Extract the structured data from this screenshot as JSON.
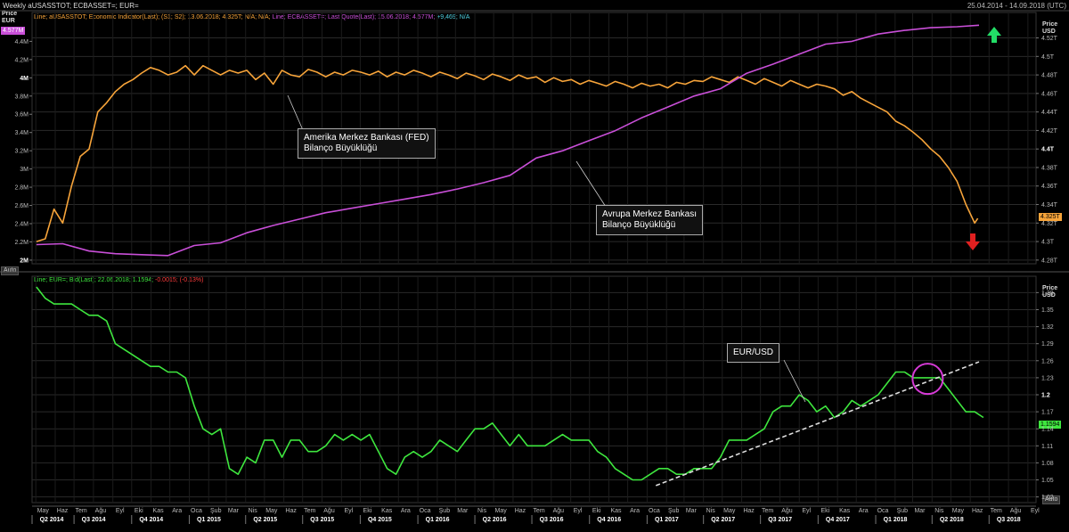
{
  "header": {
    "title": "Weekly aUSASSTOT; ECBASSET=; EUR=",
    "date_range": "25.04.2014 - 14.09.2018 (UTC)"
  },
  "top_panel": {
    "legend_parts": [
      {
        "text": "Line; aUSASSTOT; Economic Indicator(Last); (S1; S2); 13.06.2018; 4.325T; N/A; N/A;",
        "color": "#f7a43a"
      },
      {
        "text": " Line; ECBASSET=; Last Quote(Last); 15.06.2018; 4.577M;",
        "color": "#c94fd8"
      },
      {
        "text": " +9,469; N/A",
        "color": "#4fd0e0"
      }
    ],
    "left_axis_title": "Price",
    "left_axis_unit": "EUR",
    "left_chip": "4.577M",
    "right_axis_title": "Price",
    "right_axis_unit": "USD",
    "right_chip": "4.325T",
    "auto_label": "Auto"
  },
  "bottom_panel": {
    "legend_parts": [
      {
        "text": "Line; EUR=; Bid(Last); 22.06.2018; 1.1594;",
        "color": "#3ee63e"
      },
      {
        "text": " -0.0015; (-0.13%)",
        "color": "#ff3b3b"
      }
    ],
    "right_axis_title": "Price",
    "right_axis_unit": "USD",
    "right_chip": "1.1594",
    "auto_label": "Auto"
  },
  "annotations": {
    "fed": [
      "Amerika Merkez Bankası (FED)",
      "Bilanço Büyüklüğü"
    ],
    "ecb": [
      "Avrupa Merkez Bankası",
      "Bilanço Büyüklüğü"
    ],
    "eurusd": [
      "EUR/USD"
    ]
  },
  "x_axis": {
    "months": [
      "May",
      "Haz",
      "Tem",
      "Ağu",
      "Eyl",
      "Eki",
      "Kas",
      "Ara",
      "Oca",
      "Şub",
      "Mar",
      "Nis",
      "May",
      "Haz",
      "Tem",
      "Ağu",
      "Eyl",
      "Eki",
      "Kas",
      "Ara",
      "Oca",
      "Şub",
      "Mar",
      "Nis",
      "May",
      "Haz",
      "Tem",
      "Ağu",
      "Eyl",
      "Eki",
      "Kas",
      "Ara",
      "Oca",
      "Şub",
      "Mar",
      "Nis",
      "May",
      "Haz",
      "Tem",
      "Ağu",
      "Eyl",
      "Eki",
      "Kas",
      "Ara",
      "Oca",
      "Şub",
      "Mar",
      "Nis",
      "May",
      "Haz",
      "Tem",
      "Ağu",
      "Eyl"
    ],
    "quarters": [
      "Q2 2014",
      "Q3 2014",
      "Q4 2014",
      "Q1 2015",
      "Q2 2015",
      "Q3 2015",
      "Q4 2015",
      "Q1 2016",
      "Q2 2016",
      "Q3 2016",
      "Q4 2016",
      "Q1 2017",
      "Q2 2017",
      "Q3 2017",
      "Q4 2017",
      "Q1 2018",
      "Q2 2018",
      "Q3 2018"
    ]
  },
  "colors": {
    "fed": "#f7a43a",
    "ecb": "#c94fd8",
    "eurusd": "#3ee63e",
    "trendline": "#dddddd",
    "circle": "#d63ad6",
    "arrow_up": "#22dd66",
    "arrow_down": "#e02020",
    "grid": "#2a2a2a"
  },
  "chart_data": [
    {
      "type": "line",
      "title": "",
      "x_start": "2014-05",
      "x_end": "2018-09",
      "series": [
        {
          "name": "aUSASSTOT",
          "axis": "right",
          "unit": "USD",
          "dates": [
            "2014-05-02",
            "2014-05-16",
            "2014-05-30",
            "2014-06-13",
            "2014-06-27",
            "2014-07-11",
            "2014-07-25",
            "2014-08-08",
            "2014-08-22",
            "2014-09-05",
            "2014-09-19",
            "2014-10-03",
            "2014-10-17",
            "2014-10-31",
            "2014-11-14",
            "2014-11-28",
            "2014-12-12",
            "2014-12-26",
            "2015-01-09",
            "2015-01-23",
            "2015-02-06",
            "2015-02-20",
            "2015-03-06",
            "2015-03-20",
            "2015-04-03",
            "2015-04-17",
            "2015-05-01",
            "2015-05-15",
            "2015-05-29",
            "2015-06-12",
            "2015-06-26",
            "2015-07-10",
            "2015-07-24",
            "2015-08-07",
            "2015-08-21",
            "2015-09-04",
            "2015-09-18",
            "2015-10-02",
            "2015-10-16",
            "2015-10-30",
            "2015-11-13",
            "2015-11-27",
            "2015-12-11",
            "2015-12-25",
            "2016-01-08",
            "2016-01-22",
            "2016-02-05",
            "2016-02-19",
            "2016-03-04",
            "2016-03-18",
            "2016-04-01",
            "2016-04-15",
            "2016-04-29",
            "2016-05-13",
            "2016-05-27",
            "2016-06-10",
            "2016-06-24",
            "2016-07-08",
            "2016-07-22",
            "2016-08-05",
            "2016-08-19",
            "2016-09-02",
            "2016-09-16",
            "2016-09-30",
            "2016-10-14",
            "2016-10-28",
            "2016-11-11",
            "2016-11-25",
            "2016-12-09",
            "2016-12-23",
            "2017-01-06",
            "2017-01-20",
            "2017-02-03",
            "2017-02-17",
            "2017-03-03",
            "2017-03-17",
            "2017-03-31",
            "2017-04-14",
            "2017-04-28",
            "2017-05-12",
            "2017-05-26",
            "2017-06-09",
            "2017-06-23",
            "2017-07-07",
            "2017-07-21",
            "2017-08-04",
            "2017-08-18",
            "2017-09-01",
            "2017-09-15",
            "2017-09-29",
            "2017-10-13",
            "2017-10-27",
            "2017-11-10",
            "2017-11-24",
            "2017-12-08",
            "2017-12-22",
            "2018-01-05",
            "2018-01-19",
            "2018-02-02",
            "2018-02-16",
            "2018-03-02",
            "2018-03-16",
            "2018-03-30",
            "2018-04-13",
            "2018-04-27",
            "2018-05-11",
            "2018-05-25",
            "2018-06-08",
            "2018-06-13"
          ],
          "values": [
            4.3,
            4.303,
            4.335,
            4.32,
            4.36,
            4.392,
            4.4,
            4.44,
            4.45,
            4.462,
            4.47,
            4.475,
            4.482,
            4.488,
            4.485,
            4.48,
            4.483,
            4.49,
            4.48,
            4.49,
            4.485,
            4.48,
            4.485,
            4.482,
            4.485,
            4.475,
            4.482,
            4.47,
            4.485,
            4.48,
            4.478,
            4.486,
            4.483,
            4.478,
            4.483,
            4.48,
            4.485,
            4.483,
            4.48,
            4.484,
            4.478,
            4.483,
            4.48,
            4.485,
            4.482,
            4.478,
            4.483,
            4.48,
            4.476,
            4.482,
            4.479,
            4.475,
            4.481,
            4.478,
            4.474,
            4.48,
            4.476,
            4.478,
            4.472,
            4.477,
            4.473,
            4.475,
            4.47,
            4.474,
            4.471,
            4.468,
            4.473,
            4.47,
            4.466,
            4.471,
            4.468,
            4.47,
            4.466,
            4.472,
            4.47,
            4.474,
            4.473,
            4.478,
            4.475,
            4.472,
            4.478,
            4.474,
            4.47,
            4.476,
            4.472,
            4.468,
            4.474,
            4.47,
            4.466,
            4.47,
            4.468,
            4.465,
            4.458,
            4.462,
            4.455,
            4.45,
            4.445,
            4.44,
            4.43,
            4.425,
            4.418,
            4.41,
            4.4,
            4.392,
            4.38,
            4.365,
            4.34,
            4.32,
            4.325
          ]
        },
        {
          "name": "ECBASSET=",
          "axis": "left",
          "unit": "EUR",
          "dates": [
            "2014-05-02",
            "2014-06-13",
            "2014-07-25",
            "2014-09-05",
            "2014-10-17",
            "2014-11-28",
            "2015-01-09",
            "2015-02-20",
            "2015-04-03",
            "2015-05-15",
            "2015-06-26",
            "2015-08-07",
            "2015-09-18",
            "2015-10-30",
            "2015-12-11",
            "2016-01-22",
            "2016-03-04",
            "2016-04-15",
            "2016-05-27",
            "2016-07-08",
            "2016-08-19",
            "2016-09-30",
            "2016-11-11",
            "2016-12-23",
            "2017-02-03",
            "2017-03-17",
            "2017-04-28",
            "2017-06-09",
            "2017-07-21",
            "2017-09-01",
            "2017-10-13",
            "2017-11-24",
            "2018-01-05",
            "2018-02-16",
            "2018-03-30",
            "2018-05-11",
            "2018-06-15"
          ],
          "values": [
            2.17,
            2.18,
            2.1,
            2.07,
            2.06,
            2.05,
            2.16,
            2.19,
            2.3,
            2.38,
            2.45,
            2.52,
            2.57,
            2.62,
            2.67,
            2.72,
            2.78,
            2.85,
            2.93,
            3.12,
            3.2,
            3.31,
            3.42,
            3.56,
            3.68,
            3.8,
            3.88,
            4.05,
            4.15,
            4.26,
            4.37,
            4.4,
            4.48,
            4.52,
            4.55,
            4.56,
            4.577
          ]
        }
      ],
      "left_axis": {
        "ticks": [
          "2M",
          "2.2M",
          "2.4M",
          "2.6M",
          "2.8M",
          "3M",
          "3.2M",
          "3.4M",
          "3.6M",
          "3.8M",
          "4M",
          "4.2M",
          "4.4M"
        ],
        "bold": [
          "2M",
          "4M"
        ]
      },
      "right_axis": {
        "ticks": [
          "4.28T",
          "4.3T",
          "4.32T",
          "4.34T",
          "4.36T",
          "4.38T",
          "4.4T",
          "4.42T",
          "4.44T",
          "4.46T",
          "4.48T",
          "4.5T",
          "4.52T"
        ],
        "bold": [
          "4.4T"
        ]
      },
      "ylim_left": [
        1.96,
        4.58
      ],
      "ylim_right": [
        4.276,
        4.534
      ]
    },
    {
      "type": "line",
      "title": "",
      "series": [
        {
          "name": "EUR=",
          "dates": [
            "2014-05-02",
            "2014-05-16",
            "2014-05-30",
            "2014-06-13",
            "2014-06-27",
            "2014-07-11",
            "2014-07-25",
            "2014-08-08",
            "2014-08-22",
            "2014-09-05",
            "2014-09-19",
            "2014-10-03",
            "2014-10-17",
            "2014-10-31",
            "2014-11-14",
            "2014-11-28",
            "2014-12-12",
            "2014-12-26",
            "2015-01-09",
            "2015-01-23",
            "2015-02-06",
            "2015-02-20",
            "2015-03-06",
            "2015-03-20",
            "2015-04-03",
            "2015-04-17",
            "2015-05-01",
            "2015-05-15",
            "2015-05-29",
            "2015-06-12",
            "2015-06-26",
            "2015-07-10",
            "2015-07-24",
            "2015-08-07",
            "2015-08-21",
            "2015-09-04",
            "2015-09-18",
            "2015-10-02",
            "2015-10-16",
            "2015-10-30",
            "2015-11-13",
            "2015-11-27",
            "2015-12-11",
            "2015-12-25",
            "2016-01-08",
            "2016-01-22",
            "2016-02-05",
            "2016-02-19",
            "2016-03-04",
            "2016-03-18",
            "2016-04-01",
            "2016-04-15",
            "2016-04-29",
            "2016-05-13",
            "2016-05-27",
            "2016-06-10",
            "2016-06-24",
            "2016-07-08",
            "2016-07-22",
            "2016-08-05",
            "2016-08-19",
            "2016-09-02",
            "2016-09-16",
            "2016-09-30",
            "2016-10-14",
            "2016-10-28",
            "2016-11-11",
            "2016-11-25",
            "2016-12-09",
            "2016-12-23",
            "2017-01-06",
            "2017-01-20",
            "2017-02-03",
            "2017-02-17",
            "2017-03-03",
            "2017-03-17",
            "2017-03-31",
            "2017-04-14",
            "2017-04-28",
            "2017-05-12",
            "2017-05-26",
            "2017-06-09",
            "2017-06-23",
            "2017-07-07",
            "2017-07-21",
            "2017-08-04",
            "2017-08-18",
            "2017-09-01",
            "2017-09-15",
            "2017-09-29",
            "2017-10-13",
            "2017-10-27",
            "2017-11-10",
            "2017-11-24",
            "2017-12-08",
            "2017-12-22",
            "2018-01-05",
            "2018-01-19",
            "2018-02-02",
            "2018-02-16",
            "2018-03-02",
            "2018-03-16",
            "2018-03-30",
            "2018-04-13",
            "2018-04-27",
            "2018-05-11",
            "2018-05-25",
            "2018-06-08",
            "2018-06-22"
          ],
          "values": [
            1.39,
            1.37,
            1.36,
            1.36,
            1.36,
            1.35,
            1.34,
            1.34,
            1.33,
            1.29,
            1.28,
            1.27,
            1.26,
            1.25,
            1.25,
            1.24,
            1.24,
            1.23,
            1.18,
            1.14,
            1.13,
            1.14,
            1.07,
            1.06,
            1.09,
            1.08,
            1.12,
            1.12,
            1.09,
            1.12,
            1.12,
            1.1,
            1.1,
            1.11,
            1.13,
            1.12,
            1.13,
            1.12,
            1.13,
            1.1,
            1.07,
            1.06,
            1.09,
            1.1,
            1.09,
            1.1,
            1.12,
            1.11,
            1.1,
            1.12,
            1.14,
            1.14,
            1.15,
            1.13,
            1.11,
            1.13,
            1.11,
            1.11,
            1.11,
            1.12,
            1.13,
            1.12,
            1.12,
            1.12,
            1.1,
            1.09,
            1.07,
            1.06,
            1.05,
            1.05,
            1.06,
            1.07,
            1.07,
            1.06,
            1.06,
            1.07,
            1.07,
            1.07,
            1.09,
            1.12,
            1.12,
            1.12,
            1.13,
            1.14,
            1.17,
            1.18,
            1.18,
            1.2,
            1.19,
            1.17,
            1.18,
            1.16,
            1.17,
            1.19,
            1.18,
            1.19,
            1.2,
            1.22,
            1.24,
            1.24,
            1.23,
            1.23,
            1.23,
            1.23,
            1.21,
            1.19,
            1.17,
            1.17,
            1.16
          ]
        }
      ],
      "right_axis": {
        "ticks": [
          "1.02",
          "1.05",
          "1.08",
          "1.11",
          "1.14",
          "1.17",
          "1.2",
          "1.23",
          "1.26",
          "1.29",
          "1.32",
          "1.35",
          "1.38"
        ],
        "bold": [
          "1.2"
        ]
      },
      "ylim": [
        1.01,
        1.39
      ]
    }
  ]
}
